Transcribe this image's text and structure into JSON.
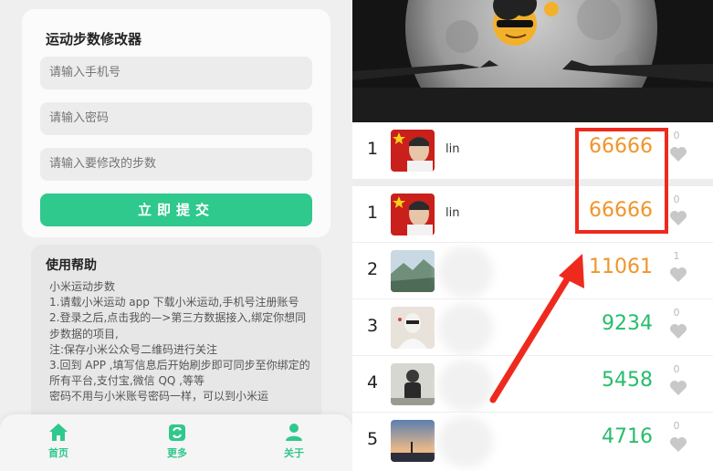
{
  "left": {
    "form": {
      "title": "运动步数修改器",
      "phone_placeholder": "请输入手机号",
      "password_placeholder": "请输入密码",
      "steps_placeholder": "请输入要修改的步数",
      "submit_label": "立即提交"
    },
    "help": {
      "title": "使用帮助",
      "lines": [
        "小米运动步数",
        "1.请载小米运动 app 下载小米运动,手机号注册账号",
        "2.登录之后,点击我的—>第三方数据接入,绑定你想同步数据的项目,",
        "注:保存小米公众号二维码进行关注",
        "3.回到 APP ,填写信息后开始刷步即可同步至你绑定的所有平台,支付宝,微信 QQ ,等等",
        "密码不用与小米账号密码一样，可以到小米运"
      ]
    },
    "nav": [
      {
        "label": "首页",
        "icon": "home-icon"
      },
      {
        "label": "更多",
        "icon": "refresh-icon"
      },
      {
        "label": "关于",
        "icon": "user-icon"
      }
    ],
    "accent_color": "#2fc88d"
  },
  "right": {
    "rows": [
      {
        "rank": "1",
        "name": "lin",
        "steps": "66666",
        "likes": "0",
        "color": "orange"
      },
      {
        "rank": "1",
        "name": "lin",
        "steps": "66666",
        "likes": "0",
        "color": "orange"
      },
      {
        "rank": "2",
        "name": "",
        "steps": "11061",
        "likes": "1",
        "color": "orange"
      },
      {
        "rank": "3",
        "name": "",
        "steps": "9234",
        "likes": "0",
        "color": "green"
      },
      {
        "rank": "4",
        "name": "",
        "steps": "5458",
        "likes": "0",
        "color": "green"
      },
      {
        "rank": "5",
        "name": "",
        "steps": "4716",
        "likes": "0",
        "color": "green"
      }
    ],
    "highlight_color": "#ee2a1e"
  }
}
